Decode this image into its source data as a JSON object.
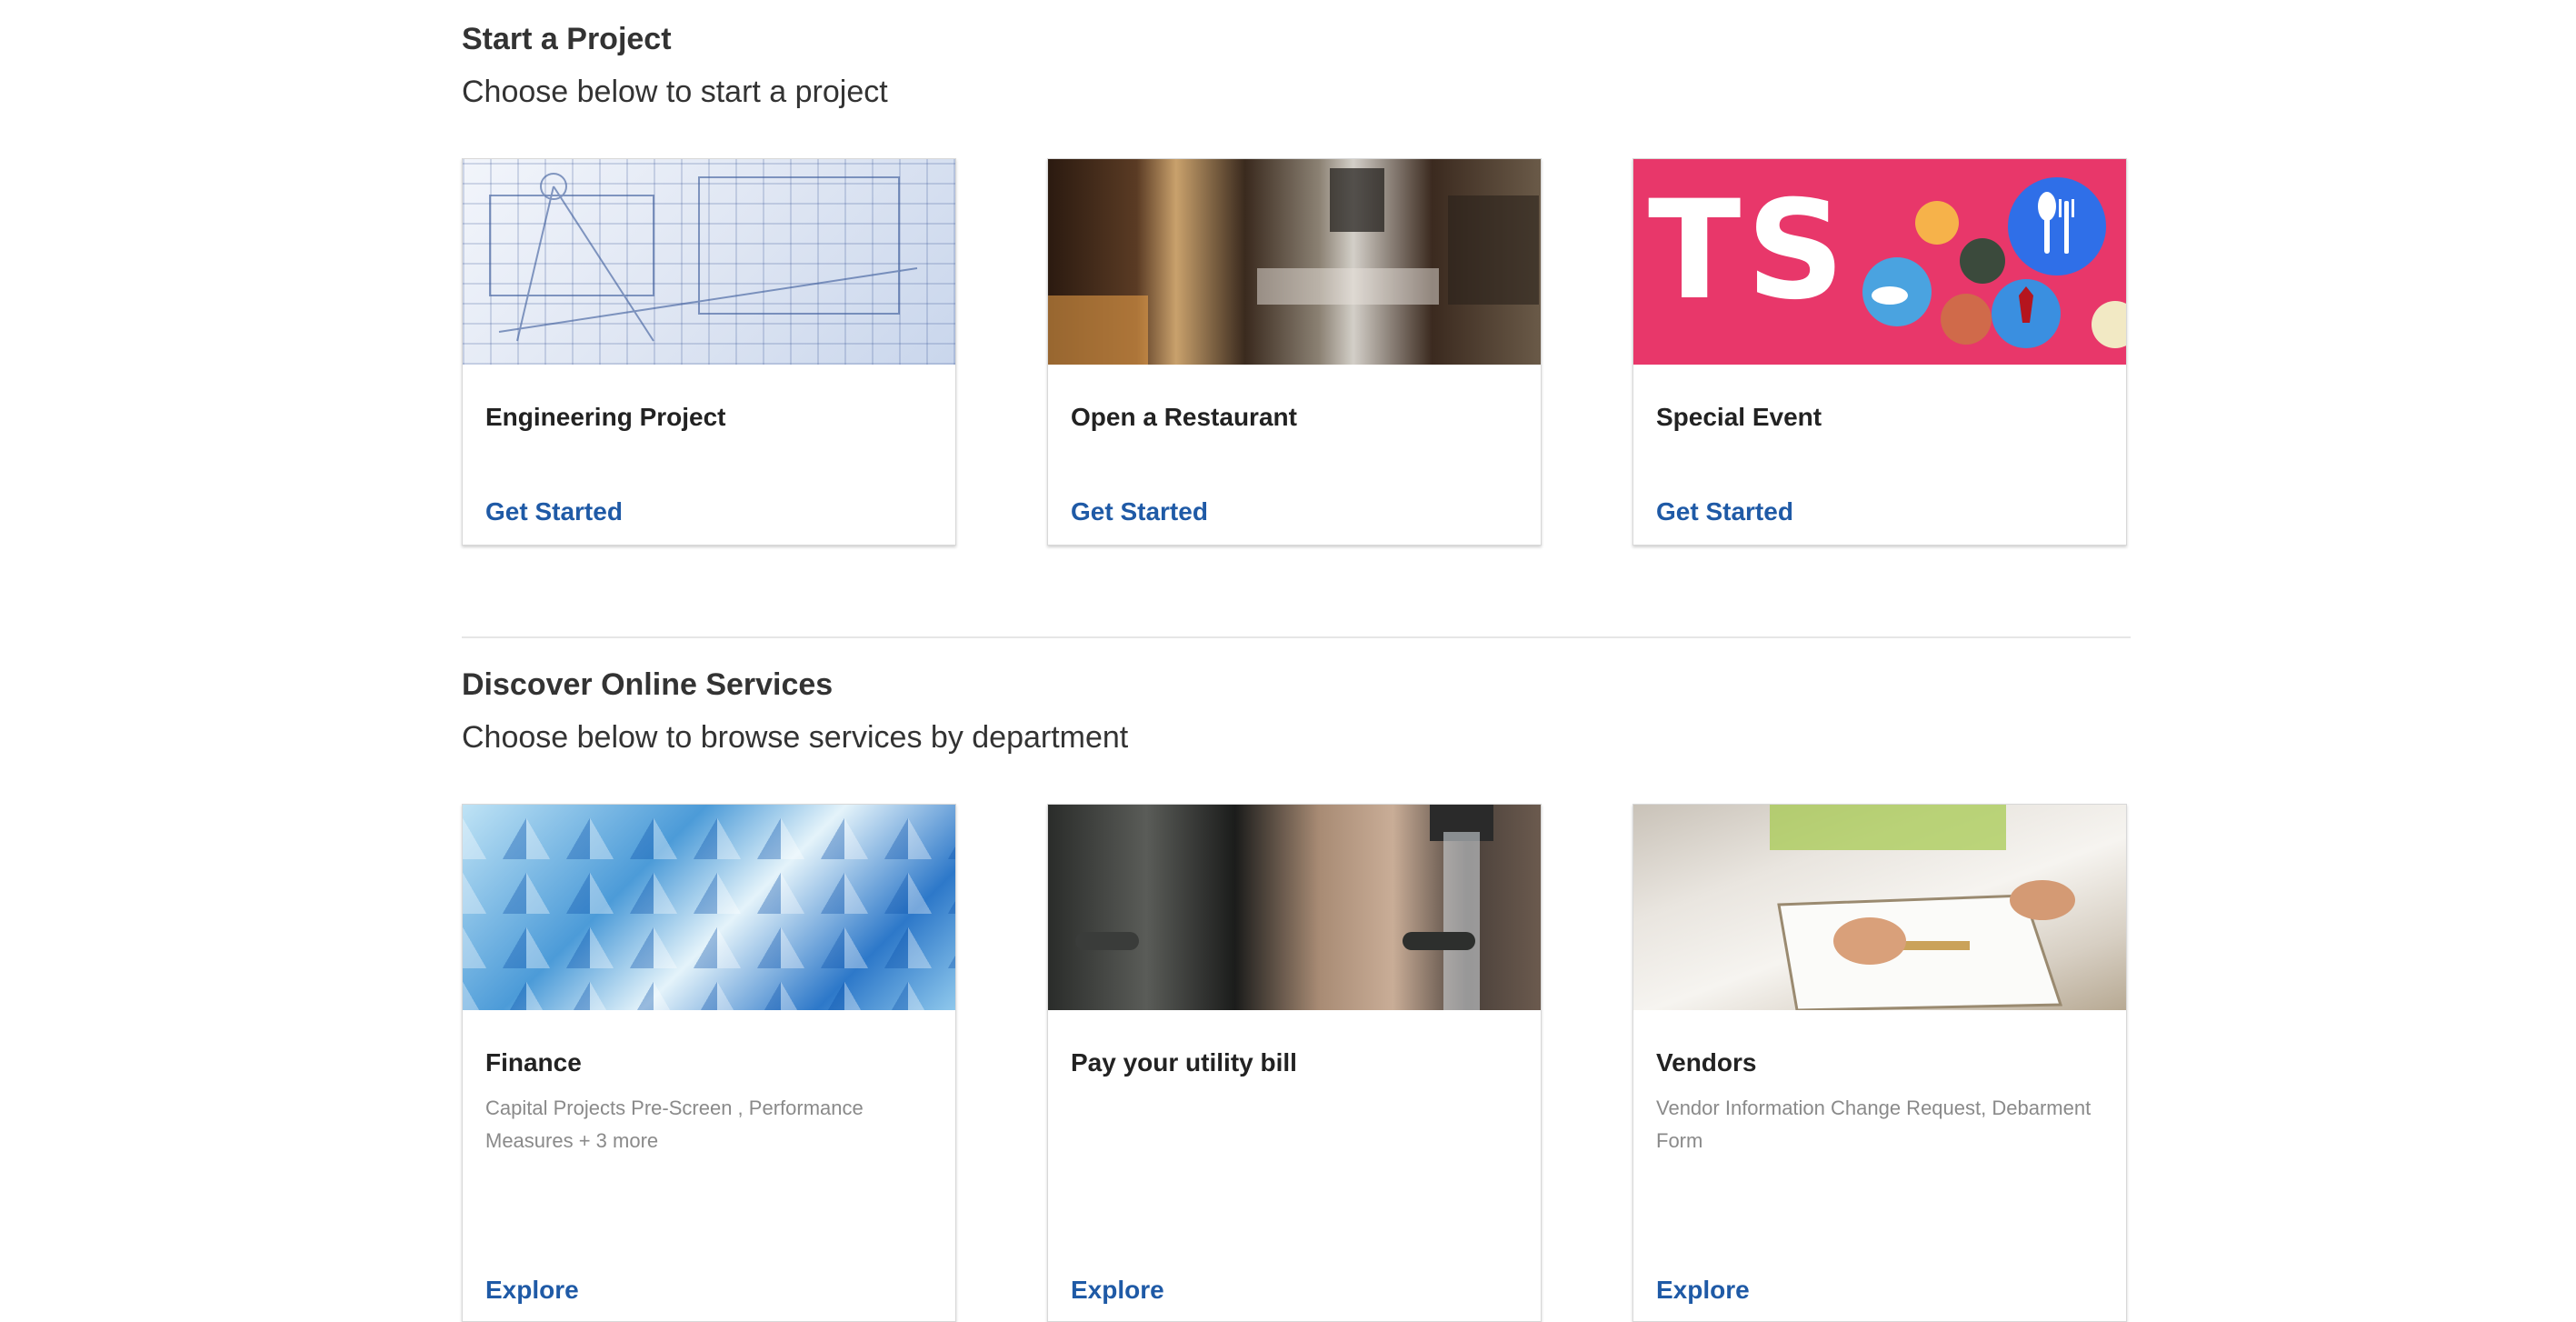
{
  "projects": {
    "title": "Start a Project",
    "subtitle": "Choose below to start a project",
    "cards": [
      {
        "title": "Engineering Project",
        "link": "Get Started",
        "image_icon": "blueprint-image"
      },
      {
        "title": "Open a Restaurant",
        "link": "Get Started",
        "image_icon": "restaurant-image"
      },
      {
        "title": "Special Event",
        "link": "Get Started",
        "image_icon": "ts-event-image",
        "image_text": "TS"
      }
    ]
  },
  "services": {
    "title": "Discover Online Services",
    "subtitle": "Choose below to browse services by department",
    "cards": [
      {
        "title": "Finance",
        "desc": "Capital Projects Pre-Screen , Performance Measures + 3 more",
        "link": "Explore",
        "image_icon": "blue-triangles-image"
      },
      {
        "title": "Pay your utility bill",
        "desc": "",
        "link": "Explore",
        "image_icon": "water-faucet-image"
      },
      {
        "title": "Vendors",
        "desc": "Vendor Information Change Request, Debarment Form",
        "link": "Explore",
        "image_icon": "clipboard-writing-image"
      }
    ]
  },
  "colors": {
    "link": "#1f5aa6",
    "ts_background": "#e8376a"
  }
}
